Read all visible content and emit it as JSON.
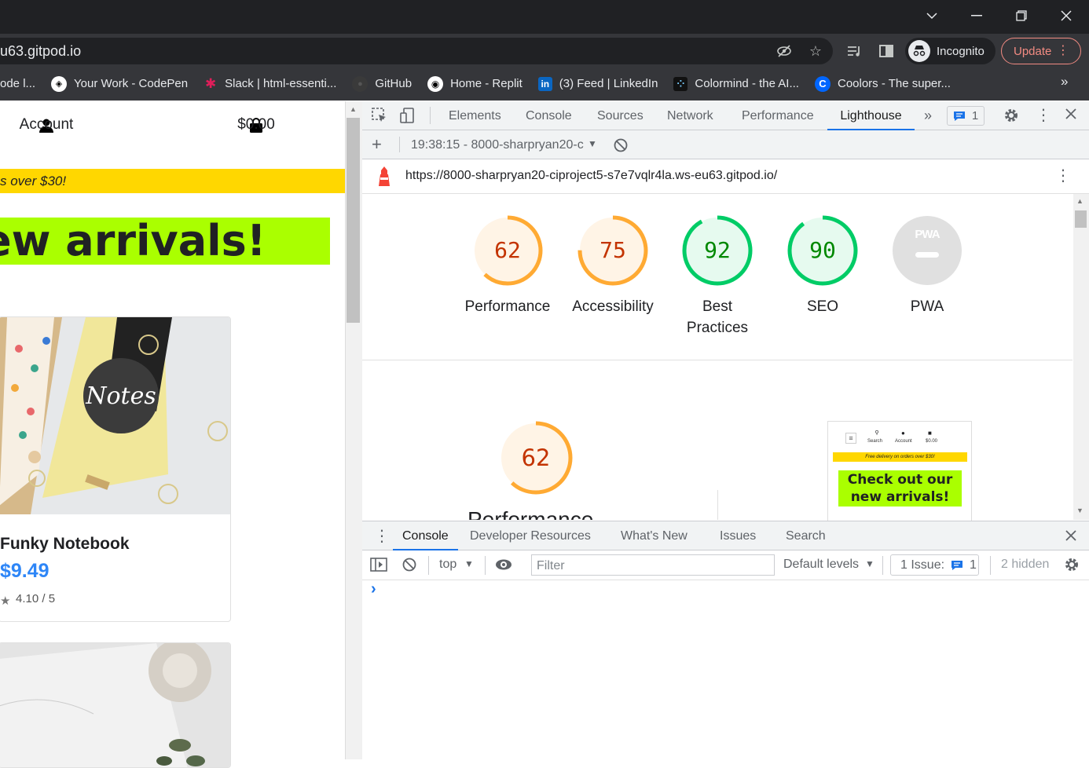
{
  "browser": {
    "url_partial": "u63.gitpod.io",
    "profile_label": "Incognito",
    "update_label": "Update",
    "bookmarks": [
      {
        "label": "ode l...",
        "icon": "codepen-icon"
      },
      {
        "label": "Your Work - CodePen",
        "icon": "codepen-icon"
      },
      {
        "label": "Slack | html-essenti...",
        "icon": "slack-icon"
      },
      {
        "label": "GitHub",
        "icon": "github-icon"
      },
      {
        "label": "Home - Replit",
        "icon": "replit-icon"
      },
      {
        "label": "(3) Feed | LinkedIn",
        "icon": "linkedin-icon"
      },
      {
        "label": "Colormind - the AI...",
        "icon": "colormind-icon"
      },
      {
        "label": "Coolors - The super...",
        "icon": "coolors-icon"
      }
    ],
    "more_bookmarks": "»"
  },
  "site": {
    "account_label": "Account",
    "cart_total": "$0.00",
    "promo_text": "s over $30!",
    "arrivals_text": "ew arrivals!",
    "product": {
      "name": "Funky Notebook",
      "price": "$9.49",
      "rating": "4.10 / 5",
      "image_text": "Notes"
    }
  },
  "devtools": {
    "tabs": [
      "Elements",
      "Console",
      "Sources",
      "Network",
      "Performance",
      "Lighthouse"
    ],
    "active_tab": "Lighthouse",
    "more_tabs": "»",
    "issues_count": "1",
    "report_label": "19:38:15 - 8000-sharpryan20-c",
    "audited_url": "https://8000-sharpryan20-ciproject5-s7e7vqlr4la.ws-eu63.gitpod.io/",
    "scores": [
      {
        "label": "Performance",
        "score": 62,
        "color": "#fa3"
      },
      {
        "label": "Accessibility",
        "score": 75,
        "color": "#fa3"
      },
      {
        "label": "Best Practices",
        "score": 92,
        "color": "#0c6"
      },
      {
        "label": "SEO",
        "score": 90,
        "color": "#0c6"
      },
      {
        "label": "PWA",
        "score": null,
        "color": "#ccc"
      }
    ],
    "pwa_badge": "PWA",
    "detail_score": 62,
    "detail_label": "Performance",
    "thumbnail": {
      "search": "Search",
      "account": "Account",
      "cart": "$0.00",
      "promo": "Free delivery on orders over $30!",
      "banner": "Check out our new arrivals!"
    }
  },
  "drawer": {
    "tabs": [
      "Console",
      "Developer Resources",
      "What's New",
      "Issues",
      "Search"
    ],
    "active_tab": "Console",
    "context": "top",
    "filter_placeholder": "Filter",
    "levels": "Default levels",
    "issues_label": "1 Issue:",
    "issues_count": "1",
    "hidden_label": "2 hidden",
    "prompt": "›"
  }
}
